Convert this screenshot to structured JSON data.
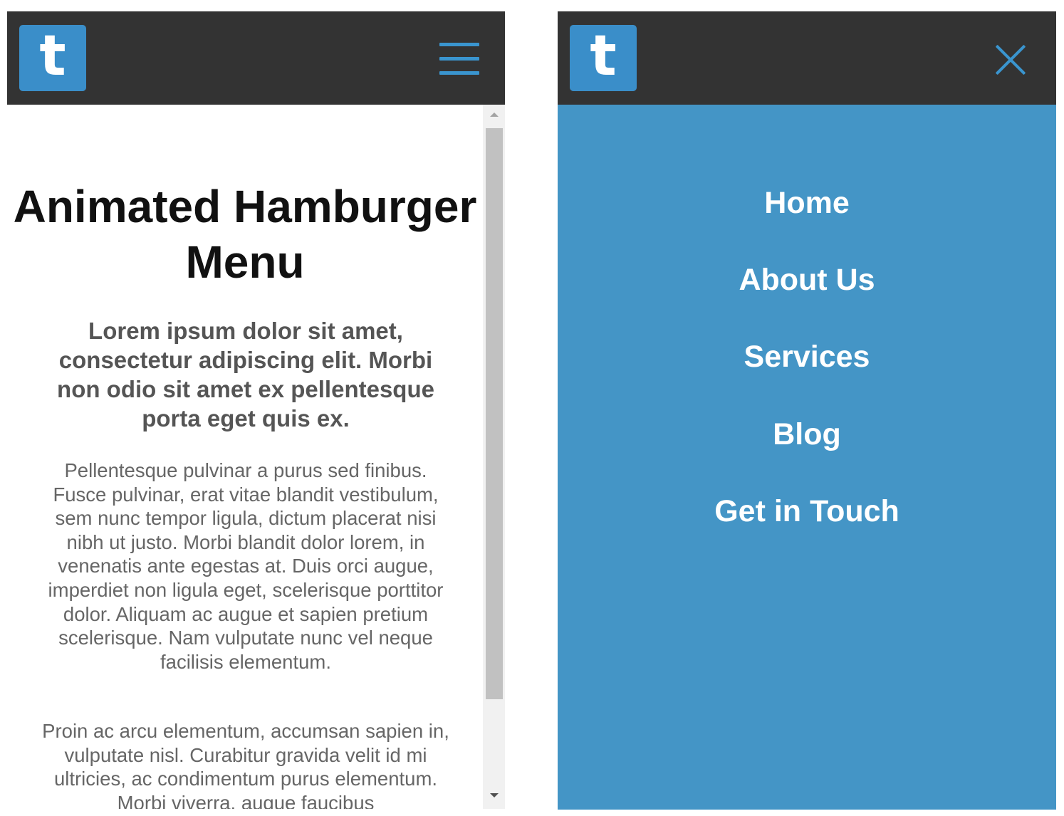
{
  "closed_view": {
    "logo_letter": "t",
    "title": "Animated Hamburger Menu",
    "subtitle": "Lorem ipsum dolor sit amet, consectetur adipiscing elit. Morbi non odio sit amet ex pellentesque porta eget quis ex.",
    "paragraphs": [
      "Pellentesque pulvinar a purus sed finibus. Fusce pulvinar, erat vitae blandit vestibulum, sem nunc tempor ligula, dictum placerat nisi nibh ut justo. Morbi blandit dolor lorem, in venenatis ante egestas at. Duis orci augue, imperdiet non ligula eget, scelerisque porttitor dolor. Aliquam ac augue et sapien pretium scelerisque. Nam vulputate nunc vel neque facilisis elementum.",
      "Proin ac arcu elementum, accumsan sapien in, vulputate nisl. Curabitur gravida velit id mi ultricies, ac condimentum purus elementum. Morbi viverra, augue faucibus"
    ],
    "menu_icon": "hamburger-icon"
  },
  "open_view": {
    "logo_letter": "t",
    "close_icon": "close-icon",
    "menu_items": [
      "Home",
      "About Us",
      "Services",
      "Blog",
      "Get in Touch"
    ]
  },
  "colors": {
    "header_bg": "#333333",
    "logo_bg": "#3a8ec9",
    "accent": "#3a95cf",
    "menu_bg": "#4495c6",
    "title_text": "#111111",
    "subtitle_text": "#555555",
    "body_text": "#666666"
  }
}
